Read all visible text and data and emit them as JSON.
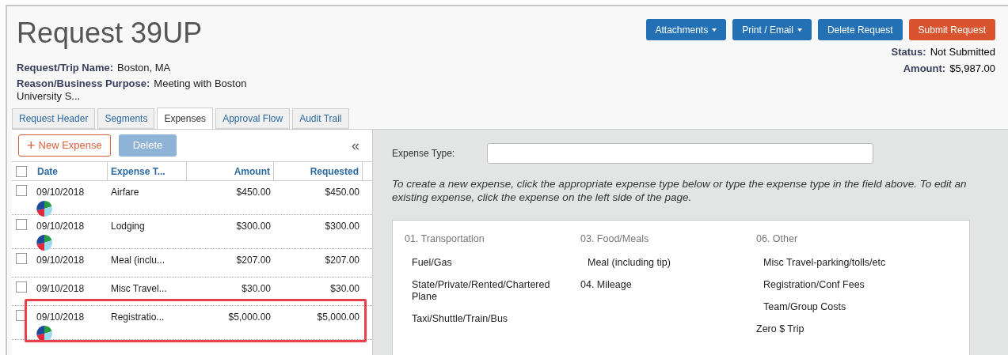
{
  "title": "Request 39UP",
  "fields": [
    {
      "label": "Request/Trip Name:",
      "value": "Boston, MA"
    },
    {
      "label": "Reason/Business Purpose:",
      "value": "Meeting with Boston University S..."
    }
  ],
  "buttons": [
    {
      "label": "Attachments",
      "kind": "dropdown"
    },
    {
      "label": "Print / Email",
      "kind": "dropdown"
    },
    {
      "label": "Delete Request",
      "kind": "primary"
    },
    {
      "label": "Submit Request",
      "kind": "submit"
    }
  ],
  "summary": [
    {
      "label": "Status:",
      "value": "Not Submitted"
    },
    {
      "label": "Amount:",
      "value": "$5,987.00"
    }
  ],
  "tabs": [
    {
      "label": "Request Header",
      "selected": false
    },
    {
      "label": "Segments",
      "selected": false
    },
    {
      "label": "Expenses",
      "selected": true
    },
    {
      "label": "Approval Flow",
      "selected": false
    },
    {
      "label": "Audit Trail",
      "selected": false
    }
  ],
  "toolbar": {
    "new_button": {
      "icon": "+",
      "label": "New Expense"
    },
    "delete_button": {
      "label": "Delete",
      "disabled": true
    },
    "collapse": "«"
  },
  "table": {
    "all_checked": false,
    "columns": [
      "Date",
      "Expense T...",
      "Amount",
      "Requested"
    ],
    "rows": [
      {
        "checked": false,
        "date": "09/10/2018",
        "type": "Airfare",
        "amount": "$450.00",
        "requested": "$450.00",
        "allocated": true,
        "highlighted": false
      },
      {
        "checked": false,
        "date": "09/10/2018",
        "type": "Lodging",
        "amount": "$300.00",
        "requested": "$300.00",
        "allocated": true,
        "highlighted": false
      },
      {
        "checked": false,
        "date": "09/10/2018",
        "type": "Meal (inclu...",
        "amount": "$207.00",
        "requested": "$207.00",
        "allocated": false,
        "highlighted": false
      },
      {
        "checked": false,
        "date": "09/10/2018",
        "type": "Misc Travel...",
        "amount": "$30.00",
        "requested": "$30.00",
        "allocated": false,
        "highlighted": false
      },
      {
        "checked": false,
        "date": "09/10/2018",
        "type": "Registratio...",
        "amount": "$5,000.00",
        "requested": "$5,000.00",
        "allocated": true,
        "highlighted": true
      }
    ]
  },
  "expense_type": {
    "label": "Expense Type:",
    "hint": "To create a new expense, click the appropriate expense type below or type the expense type in the field above. To edit an existing expense, click the expense on the left side of the page."
  },
  "categories": [
    [
      {
        "kind": "group",
        "label": "01. Transportation"
      },
      {
        "kind": "item",
        "label": "Fuel/Gas"
      },
      {
        "kind": "item",
        "label": "State/Private/Rented/Chartered Plane"
      },
      {
        "kind": "item",
        "label": "Taxi/Shuttle/Train/Bus"
      }
    ],
    [
      {
        "kind": "group",
        "label": "03. Food/Meals"
      },
      {
        "kind": "item",
        "label": "Meal (including tip)"
      },
      {
        "kind": "top",
        "label": "04. Mileage"
      }
    ],
    [
      {
        "kind": "group",
        "label": "06. Other"
      },
      {
        "kind": "item",
        "label": "Misc Travel-parking/tolls/etc"
      },
      {
        "kind": "item",
        "label": "Registration/Conf Fees"
      },
      {
        "kind": "item",
        "label": "Team/Group Costs"
      },
      {
        "kind": "top",
        "label": "Zero $ Trip"
      }
    ]
  ]
}
